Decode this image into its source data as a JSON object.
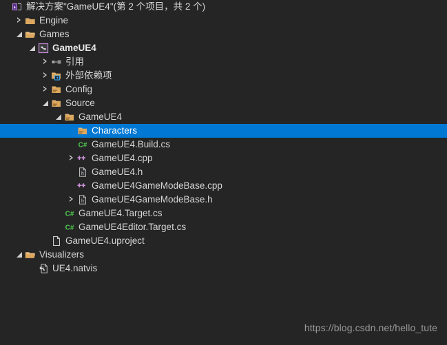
{
  "window": {
    "background": "#252526",
    "selection_color": "#0078d4",
    "text_color": "#d6d6d6",
    "folder_color": "#e8ae63"
  },
  "watermark": "https://blog.csdn.net/hello_tute",
  "tree": {
    "nodes": [
      {
        "label": "解决方案\"GameUE4\"(第 2 个项目，共 2 个)",
        "icon": "solution-icon",
        "depth": 0,
        "arrow": "none",
        "selected": false,
        "bold": false
      },
      {
        "label": "Engine",
        "icon": "folder-closed-icon",
        "depth": 1,
        "arrow": "collapsed",
        "selected": false,
        "bold": false
      },
      {
        "label": "Games",
        "icon": "folder-open-icon",
        "depth": 1,
        "arrow": "expanded",
        "selected": false,
        "bold": false
      },
      {
        "label": "GameUE4",
        "icon": "project-icon",
        "depth": 2,
        "arrow": "expanded",
        "selected": false,
        "bold": true
      },
      {
        "label": "引用",
        "icon": "references-icon",
        "depth": 3,
        "arrow": "collapsed",
        "selected": false,
        "bold": false
      },
      {
        "label": "外部依赖项",
        "icon": "external-dependencies-icon",
        "depth": 3,
        "arrow": "collapsed",
        "selected": false,
        "bold": false
      },
      {
        "label": "Config",
        "icon": "filter-folder-icon",
        "depth": 3,
        "arrow": "collapsed",
        "selected": false,
        "bold": false
      },
      {
        "label": "Source",
        "icon": "filter-folder-icon",
        "depth": 3,
        "arrow": "expanded",
        "selected": false,
        "bold": false
      },
      {
        "label": "GameUE4",
        "icon": "filter-folder-icon",
        "depth": 4,
        "arrow": "expanded",
        "selected": false,
        "bold": false
      },
      {
        "label": "Characters",
        "icon": "filter-folder-icon",
        "depth": 5,
        "arrow": "none",
        "selected": true,
        "bold": false
      },
      {
        "label": "GameUE4.Build.cs",
        "icon": "csharp-file-icon",
        "depth": 5,
        "arrow": "none",
        "selected": false,
        "bold": false
      },
      {
        "label": "GameUE4.cpp",
        "icon": "cpp-file-icon",
        "depth": 5,
        "arrow": "collapsed",
        "selected": false,
        "bold": false
      },
      {
        "label": "GameUE4.h",
        "icon": "header-file-icon",
        "depth": 5,
        "arrow": "none",
        "selected": false,
        "bold": false
      },
      {
        "label": "GameUE4GameModeBase.cpp",
        "icon": "cpp-file-icon",
        "depth": 5,
        "arrow": "none",
        "selected": false,
        "bold": false
      },
      {
        "label": "GameUE4GameModeBase.h",
        "icon": "header-file-icon",
        "depth": 5,
        "arrow": "collapsed",
        "selected": false,
        "bold": false
      },
      {
        "label": "GameUE4.Target.cs",
        "icon": "csharp-file-icon",
        "depth": 4,
        "arrow": "none",
        "selected": false,
        "bold": false
      },
      {
        "label": "GameUE4Editor.Target.cs",
        "icon": "csharp-file-icon",
        "depth": 4,
        "arrow": "none",
        "selected": false,
        "bold": false
      },
      {
        "label": "GameUE4.uproject",
        "icon": "document-icon",
        "depth": 3,
        "arrow": "none",
        "selected": false,
        "bold": false
      },
      {
        "label": "Visualizers",
        "icon": "folder-open-icon",
        "depth": 1,
        "arrow": "expanded",
        "selected": false,
        "bold": false
      },
      {
        "label": "UE4.natvis",
        "icon": "natvis-file-icon",
        "depth": 2,
        "arrow": "none",
        "selected": false,
        "bold": false
      }
    ]
  }
}
